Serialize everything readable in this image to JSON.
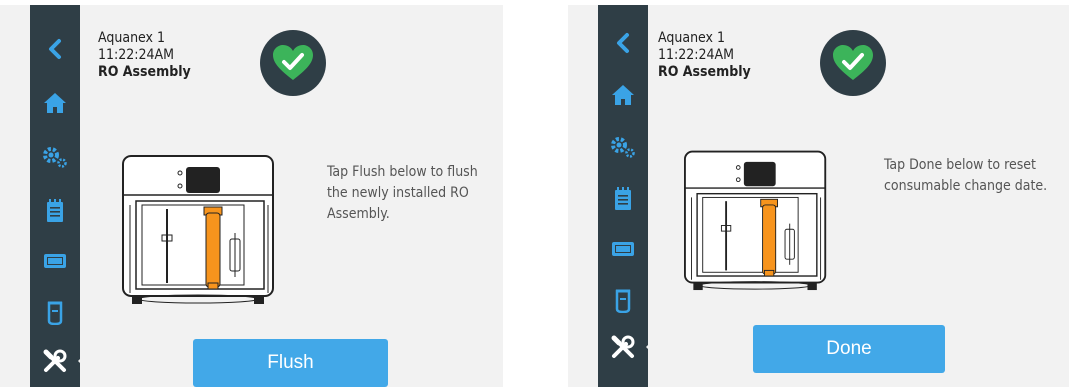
{
  "screens": [
    {
      "device_name": "Aquanex 1",
      "clock": "11:22:24AM",
      "section_title": "RO Assembly",
      "status_icon": "heart-check-icon",
      "instruction": "Tap Flush below to flush the newly installed RO Assembly.",
      "action_label": "Flush"
    },
    {
      "device_name": "Aquanex 1",
      "clock": "11:22:24AM",
      "section_title": "RO Assembly",
      "status_icon": "heart-check-icon",
      "instruction": "Tap Done below to reset consumable change date.",
      "action_label": "Done"
    }
  ],
  "sidebar": {
    "items": [
      "back-icon",
      "home-icon",
      "settings-icon",
      "log-icon",
      "filter-cartridge-icon",
      "consumable-icon",
      "tools-icon"
    ],
    "active": "tools-icon"
  },
  "colors": {
    "sidebar": "#2f3e46",
    "accent": "#42a8e8",
    "status_ok": "#3cb45a",
    "highlight_part": "#f7941d",
    "background": "#f2f2f2"
  }
}
